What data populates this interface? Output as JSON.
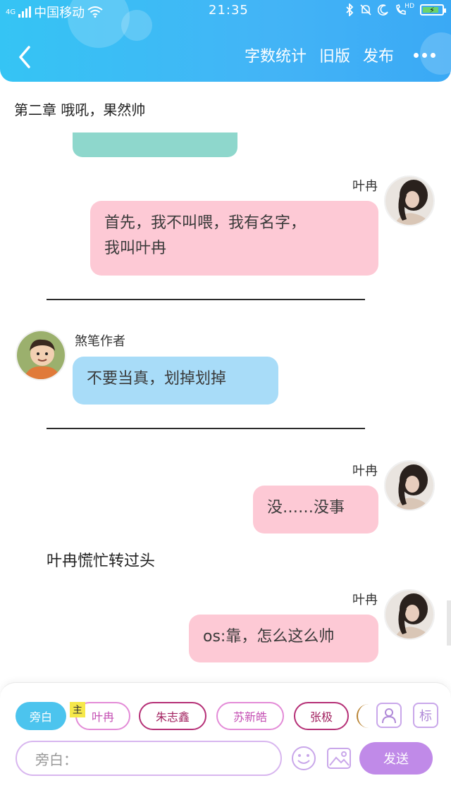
{
  "status": {
    "network": "4G",
    "carrier": "中国移动",
    "time": "21:35",
    "hd": "HD"
  },
  "nav": {
    "word_count": "字数统计",
    "old_version": "旧版",
    "publish": "发布"
  },
  "chapter_title": "第二章 哦吼，果然帅",
  "messages": [
    {
      "speaker": "叶冉",
      "text_line1": "首先，我不叫喂，我有名字，",
      "text_line2": "我叫叶冉"
    },
    {
      "speaker": "煞笔作者",
      "text": "不要当真，划掉划掉"
    },
    {
      "speaker": "叶冉",
      "text": "没……没事"
    },
    {
      "speaker": "叶冉",
      "text": "os:靠，怎么这么帅"
    }
  ],
  "narration": "叶冉慌忙转过头",
  "composer": {
    "chips": [
      "旁白",
      "叶冉",
      "朱志鑫",
      "苏新皓",
      "张极"
    ],
    "main_badge": "主",
    "tool_label": "标",
    "input_placeholder": "旁白：",
    "send_label": "发送"
  },
  "colors": {
    "header": "#3fb8f5",
    "pink_bubble": "#fdc9d5",
    "blue_bubble": "#a8dcf8",
    "send_button": "#c08ae8"
  }
}
